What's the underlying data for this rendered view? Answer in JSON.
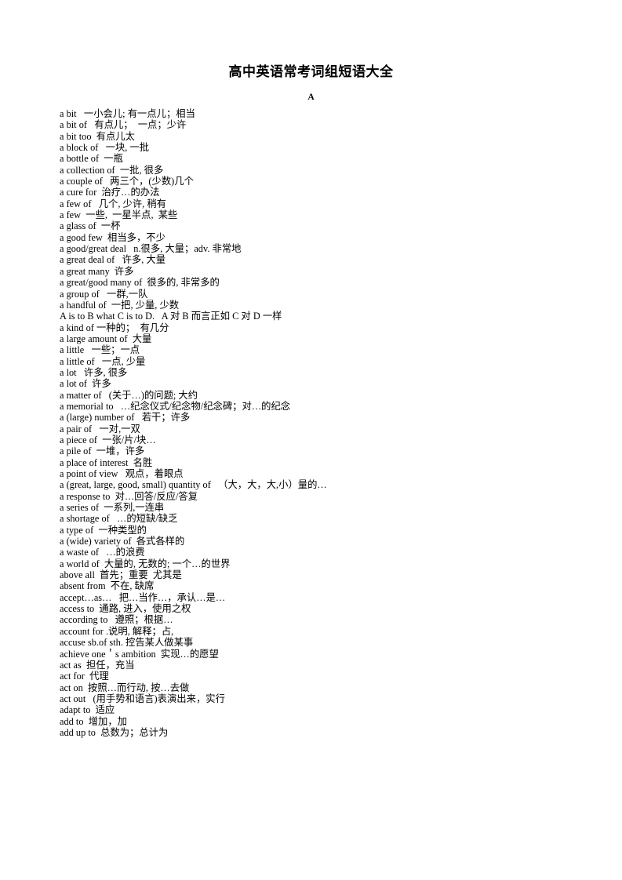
{
  "document": {
    "title": "高中英语常考词组短语大全",
    "section_heading": "A",
    "entries": [
      "a bit   一小会儿; 有一点儿；相当",
      "a bit of   有点儿；  一点；少许",
      "a bit too  有点儿太",
      "a block of   一块, 一批",
      "a bottle of  一瓶",
      "a collection of  一批, 很多",
      "a couple of   两三个，(少数)几个",
      "a cure for  治疗…的办法",
      "a few of   几个, 少许, 稍有",
      "a few  一些,  一星半点,  某些",
      "a glass of  一杯",
      "a good few  相当多，不少",
      "a good/great deal   n.很多, 大量；adv. 非常地",
      "a great deal of   许多, 大量",
      "a great many  许多",
      "a great/good many of  很多的, 非常多的",
      "a group of   一群,一队",
      "a handful of  一把, 少量, 少数",
      "A is to B what C is to D.   A 对 B 而言正如 C 对 D 一样",
      "a kind of 一种的；  有几分",
      "a large amount of  大量",
      "a little   一些；一点",
      "a little of   一点, 少量",
      "a lot   许多, 很多",
      "a lot of  许多",
      "a matter of   (关于…)的问题; 大约",
      "a memorial to   …纪念仪式/纪念物/纪念碑；对…的纪念",
      "a (large) number of   若干；许多",
      "a pair of   一对,一双",
      "a piece of  一张/片/块…",
      "a pile of  一堆，许多",
      "a place of interest  名胜",
      "a point of view   观点，着眼点",
      "a (great, large, good, small) quantity of   （大，大，大,小）量的…",
      "a response to  对…回答/反应/答复",
      "a series of  一系列,一连串",
      "a shortage of   …的短缺/缺乏",
      "a type of  一种类型的",
      "a (wide) variety of  各式各样的",
      "a waste of   …的浪费",
      "a world of  大量的, 无数的; 一个…的世界",
      "above all  首先；重要  尤其是",
      "absent from  不在, 缺席",
      "accept…as…   把…当作…，承认…是…",
      "access to  通路, 进入，使用之权",
      "according to   遵照；根据…",
      "account for .说明, 解释；占,",
      "accuse sb.of sth. 控告某人做某事",
      "achieve one＇s ambition  实现…的愿望",
      "act as  担任，充当",
      "act for  代理",
      "act on  按照…而行动, 按…去做",
      "act out   (用手势和语言)表演出来，实行",
      "adapt to  适应",
      "add to  增加，加",
      "add up to  总数为；总计为"
    ]
  }
}
